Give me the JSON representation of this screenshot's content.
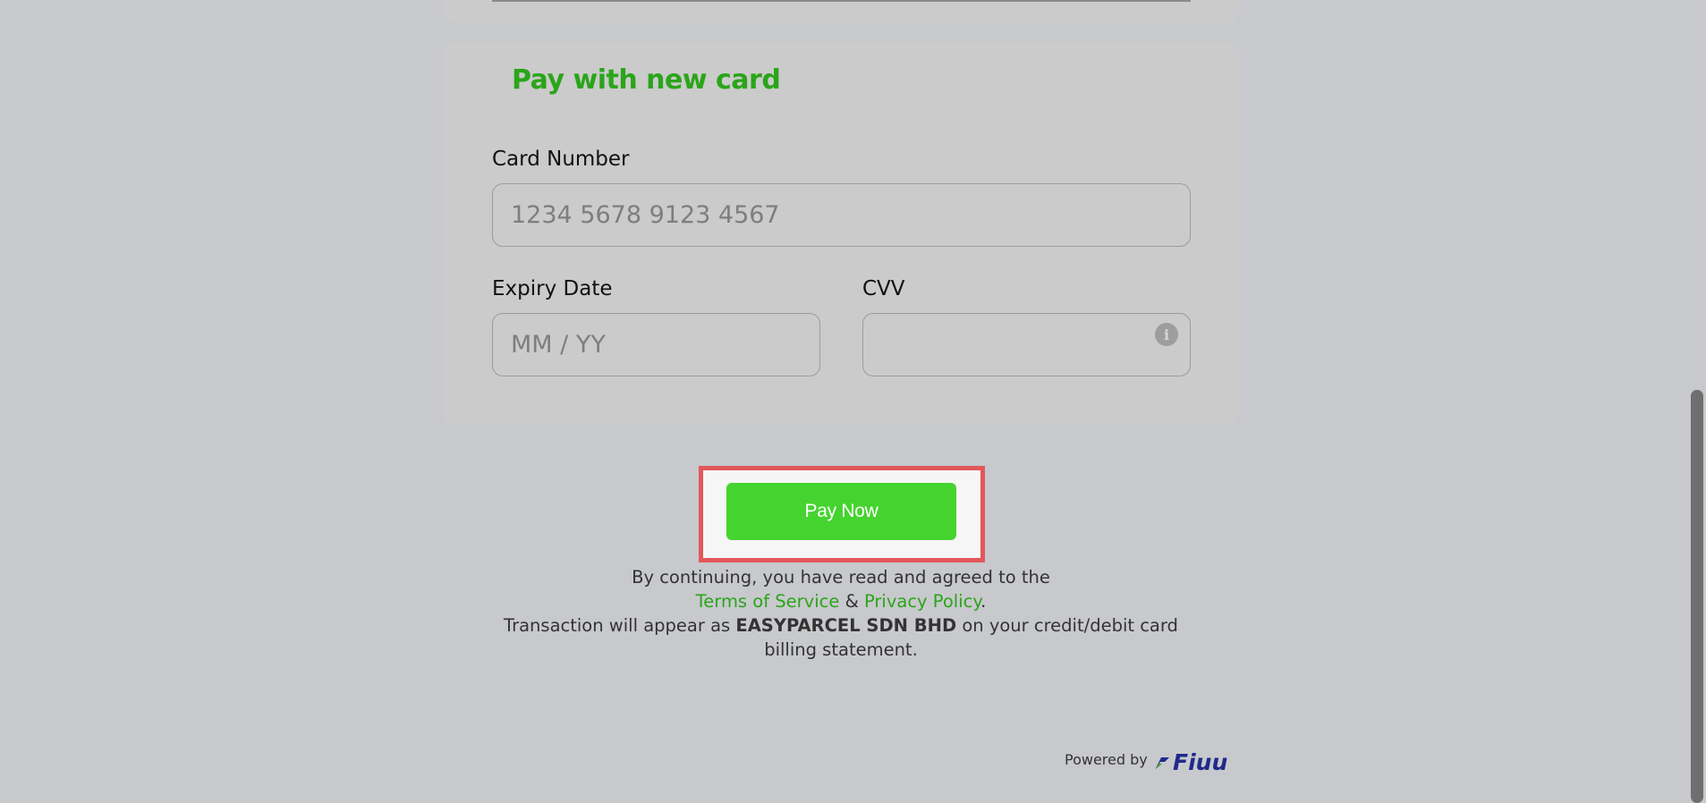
{
  "card": {
    "title": "Pay with new card",
    "card_number_label": "Card Number",
    "card_number_placeholder": "1234 5678 9123 4567",
    "expiry_label": "Expiry Date",
    "expiry_placeholder": "MM / YY",
    "cvv_label": "CVV",
    "cvv_placeholder": "",
    "cvv_info_icon": "info-icon"
  },
  "actions": {
    "pay_now_label": "Pay Now"
  },
  "legal": {
    "line1": "By continuing, you have read and agreed to the",
    "terms_link": "Terms of Service",
    "amp": "&",
    "privacy_link": "Privacy Policy",
    "period": ".",
    "transaction_prefix": "Transaction will appear as",
    "merchant_name": "EASYPARCEL SDN BHD",
    "transaction_suffix": "on your credit/debit card billing statement."
  },
  "footer": {
    "powered_by": "Powered by",
    "brand_name": "Fiuu",
    "brand_icon": "fiuu-logo-icon"
  },
  "colors": {
    "accent_green": "#2aa51a",
    "button_green": "#45d32f",
    "highlight_red": "#e2585a",
    "brand_blue": "#1f2a8a"
  }
}
